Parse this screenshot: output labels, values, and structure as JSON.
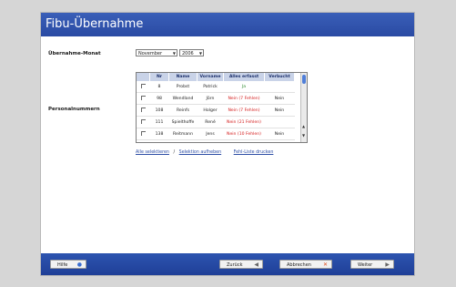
{
  "title": "Fibu-Übernahme",
  "labels": {
    "month": "Übernahme-Monat",
    "personnel": "Personalnummern"
  },
  "filters": {
    "month": "November",
    "year": "2006"
  },
  "table": {
    "headers": [
      "Nr",
      "Name",
      "Vorname",
      "Alles erfasst",
      "Verbucht"
    ],
    "rows": [
      {
        "nr": "8",
        "name": "Probst",
        "vorname": "Patrick",
        "status": "Ja",
        "status_color": "#2e8b2e",
        "verbucht": ""
      },
      {
        "nr": "98",
        "name": "Wendland",
        "vorname": "Jörn",
        "status": "Nein (7 Fehlen)",
        "status_color": "#d41b1b",
        "verbucht": "Nein"
      },
      {
        "nr": "108",
        "name": "Reinfs",
        "vorname": "Holger",
        "status": "Nein (7 Fehlen)",
        "status_color": "#d41b1b",
        "verbucht": "Nein"
      },
      {
        "nr": "111",
        "name": "Spielthoffe",
        "vorname": "René",
        "status": "Nein (21 Fehlen)",
        "status_color": "#d41b1b",
        "verbucht": ""
      },
      {
        "nr": "138",
        "name": "Reitmann",
        "vorname": "Jens",
        "status": "Nein (10 Fehlen)",
        "status_color": "#d41b1b",
        "verbucht": "Nein"
      }
    ]
  },
  "links": {
    "select_all": "Alle selektieren",
    "sep": "/",
    "clear_sel": "Selektion aufheben",
    "print_errors": "Fehl-Liste drucken"
  },
  "footer": {
    "help": "Hilfe",
    "back": "Zurück",
    "cancel": "Abbrechen",
    "next": "Weiter"
  },
  "colors": {
    "title_bar": "#3a5fb8",
    "footer_bar": "#2d54b0",
    "link": "#2f4fa6",
    "yes": "#2e8b2e",
    "no": "#d41b1b",
    "cancel_icon": "#e04a1a"
  },
  "icons": {
    "help": "help-circle-icon",
    "back": "arrow-left-icon",
    "cancel": "cross-icon",
    "next": "arrow-right-icon"
  }
}
